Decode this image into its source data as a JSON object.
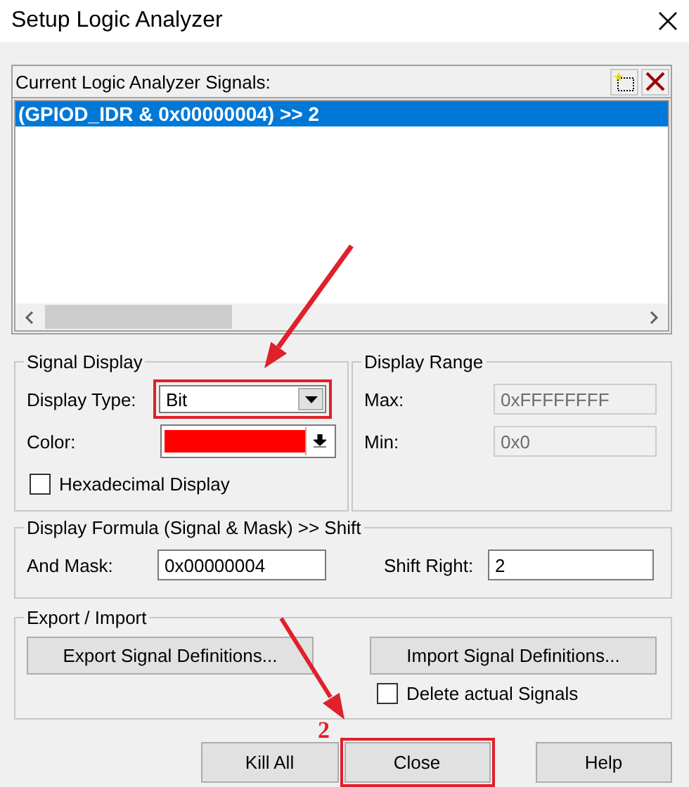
{
  "window": {
    "title": "Setup Logic Analyzer"
  },
  "signals": {
    "label": "Current Logic Analyzer Signals:",
    "items": [
      {
        "text": "(GPIOD_IDR & 0x00000004) >> 2",
        "selected": true
      }
    ]
  },
  "signal_display": {
    "title": "Signal Display",
    "display_type": {
      "label": "Display Type:",
      "value": "Bit",
      "highlighted": true
    },
    "color": {
      "label": "Color:",
      "color": "#ff0000"
    },
    "hexadecimal": {
      "label": "Hexadecimal Display",
      "checked": false
    }
  },
  "display_range": {
    "title": "Display Range",
    "fields": [
      {
        "label": "Max:",
        "value": "0xFFFFFFFF",
        "disabled": true
      },
      {
        "label": "Min:",
        "value": "0x0",
        "disabled": true
      }
    ]
  },
  "formula": {
    "title": "Display Formula (Signal & Mask) >> Shift",
    "fields": [
      {
        "label": "And Mask:",
        "value": "0x00000004"
      },
      {
        "label": "Shift Right:",
        "value": "2"
      }
    ]
  },
  "export_import": {
    "title": "Export / Import",
    "buttons": [
      "Export Signal Definitions...",
      "Import Signal Definitions..."
    ],
    "delete_signals": {
      "label": "Delete actual Signals",
      "checked": false
    }
  },
  "buttons": [
    {
      "label": "Kill All",
      "highlighted": false
    },
    {
      "label": "Close",
      "highlighted": true
    },
    {
      "label": "Help",
      "highlighted": false
    }
  ],
  "annotations": [
    {
      "label": "2"
    }
  ]
}
